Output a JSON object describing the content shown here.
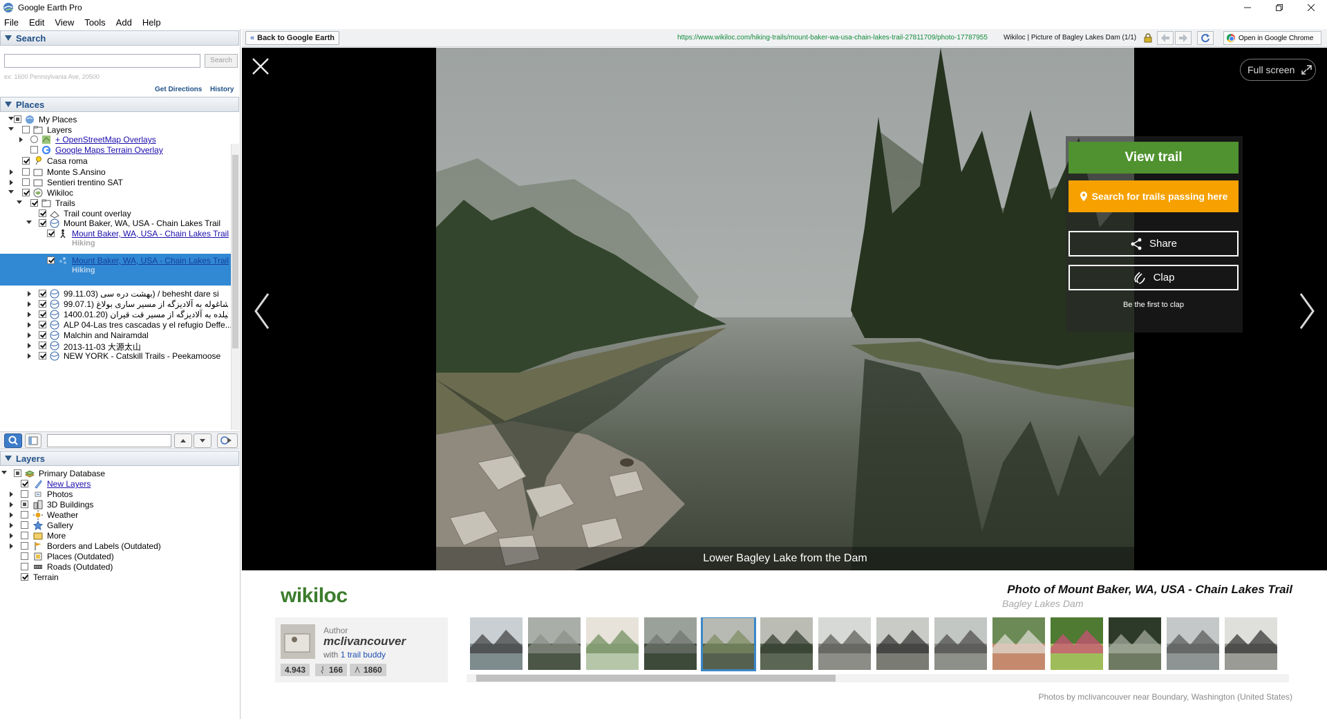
{
  "window": {
    "title": "Google Earth Pro",
    "controls": [
      "minimize-icon",
      "restore-icon",
      "close-icon"
    ]
  },
  "menu": {
    "items": [
      {
        "label": "File"
      },
      {
        "label": "Edit"
      },
      {
        "label": "View"
      },
      {
        "label": "Tools"
      },
      {
        "label": "Add"
      },
      {
        "label": "Help"
      }
    ]
  },
  "search_panel": {
    "title": "Search",
    "input_value": "",
    "button_label": "Search",
    "example": "ex: 1600 Pennsylvania Ave, 20500",
    "get_directions": "Get Directions",
    "history": "History"
  },
  "places_panel": {
    "title": "Places",
    "items": [
      {
        "label": "My Places",
        "check": "partial",
        "expanded": true
      },
      {
        "label": "Layers",
        "check": "off",
        "expanded": true
      },
      {
        "label": "+ OpenStreetMap Overlays",
        "check": "radio",
        "link": true
      },
      {
        "label": "Google Maps Terrain Overlay",
        "check": "off",
        "link": true
      },
      {
        "label": "Casa roma",
        "check": "on"
      },
      {
        "label": "Monte S.Ansino",
        "check": "off"
      },
      {
        "label": "Sentieri trentino SAT",
        "check": "off"
      },
      {
        "label": "Wikiloc",
        "check": "on",
        "expanded": true
      },
      {
        "label": "Trails",
        "check": "on",
        "expanded": true
      },
      {
        "label": "Trail count overlay",
        "check": "on"
      },
      {
        "label": "Mount Baker, WA, USA - Chain Lakes Trail",
        "check": "on",
        "expanded": true
      },
      {
        "label": "Mount Baker, WA, USA - Chain Lakes Trail",
        "sub": "Hiking",
        "check": "on",
        "link": true
      },
      {
        "label": "Mount Baker, WA, USA - Chain Lakes Trail",
        "sub": "Hiking",
        "check": "on",
        "link": true,
        "selected": true
      },
      {
        "label": "99.11.03) بهشت دره سی) / behesht dare si",
        "check": "on"
      },
      {
        "label": "99.07.1) شاغوله به آلادیزگه از مسیر ساری بولاغ",
        "check": "on"
      },
      {
        "label": "1400.01.20) گیلده به آلادیزگه از مسیر قت قیران",
        "check": "on"
      },
      {
        "label": "ALP 04-Las tres cascadas y el refugio Deffe...",
        "check": "on"
      },
      {
        "label": "Malchin and Nairamdal",
        "check": "on"
      },
      {
        "label": "2013-11-03 大源太山",
        "check": "on"
      },
      {
        "label": "NEW YORK - Catskill Trails - Peekamoose",
        "check": "on"
      }
    ]
  },
  "layers_panel": {
    "title": "Layers",
    "items": [
      {
        "label": "Primary Database",
        "check": "partial"
      },
      {
        "label": "New Layers",
        "check": "on",
        "link": true
      },
      {
        "label": "Photos",
        "check": "off"
      },
      {
        "label": "3D Buildings",
        "check": "partial"
      },
      {
        "label": "Weather",
        "check": "off"
      },
      {
        "label": "Gallery",
        "check": "off"
      },
      {
        "label": "More",
        "check": "off"
      },
      {
        "label": "Borders and Labels (Outdated)",
        "check": "off"
      },
      {
        "label": "Places (Outdated)",
        "check": "off"
      },
      {
        "label": "Roads (Outdated)",
        "check": "off"
      },
      {
        "label": "Terrain",
        "check": "on"
      }
    ]
  },
  "browser": {
    "back_label": "Back to Google Earth",
    "url": "https://www.wikiloc.com/hiking-trails/mount-baker-wa-usa-chain-lakes-trail-27811709/photo-17787955",
    "page_title": "Wikiloc | Picture of Bagley Lakes Dam (1/1)",
    "open_in_chrome": "Open in Google Chrome"
  },
  "viewer": {
    "fullscreen_label": "Full screen",
    "caption": "Lower Bagley Lake from the Dam",
    "view_trail": "View trail",
    "search_trails": "Search for trails passing here",
    "share": "Share",
    "clap": "Clap",
    "first_clap": "Be the first to clap"
  },
  "info": {
    "logo": "wikiloc",
    "photo_of": "Photo of Mount Baker, WA, USA - Chain Lakes Trail",
    "photo_sub": "Bagley Lakes Dam",
    "author_label": "Author",
    "author_name": "mclivancouver",
    "author_with_prefix": "with",
    "author_buddy": "1 trail buddy",
    "stats": [
      "4.943",
      "166",
      "1860"
    ],
    "photos_by": "Photos by mclivancouver near Boundary, Washington (United States)",
    "thumbnail_count": 14,
    "active_thumbnail": 4
  }
}
